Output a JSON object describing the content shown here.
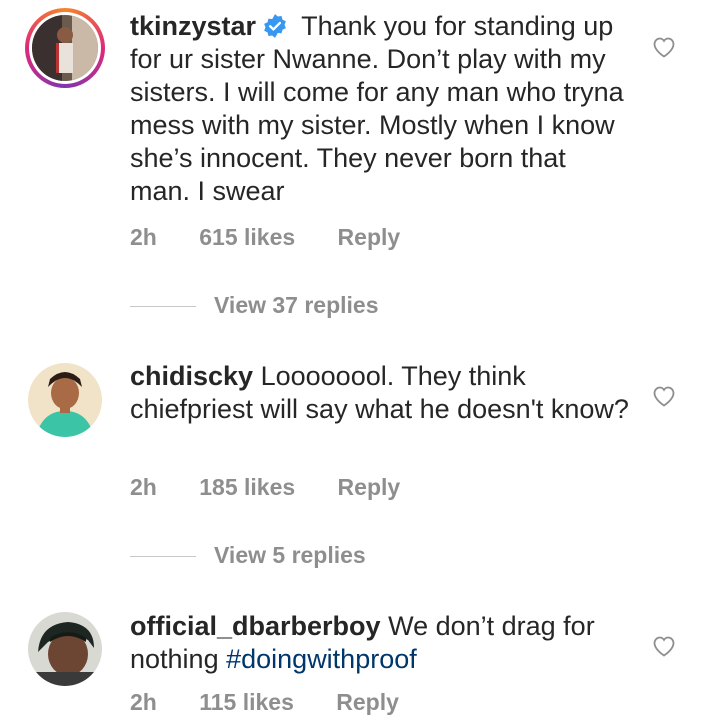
{
  "comments": [
    {
      "username": "tkinzystar",
      "verified": true,
      "text": "Thank you for standing up for ur sister Nwanne. Don’t play with my sisters. I will come for any man who tryna mess with my sister. Mostly when I know she’s innocent. They never born that man. I swear",
      "time": "2h",
      "likes": "615 likes",
      "reply_label": "Reply",
      "view_replies": "View 37 replies"
    },
    {
      "username": "chidiscky",
      "text": "Loooooool. They think chiefpriest will say what he doesn't know?",
      "time": "2h",
      "likes": "185 likes",
      "reply_label": "Reply",
      "view_replies": "View 5 replies"
    },
    {
      "username": "official_dbarberboy",
      "text": "We don’t drag for nothing",
      "hashtag": "#doingwithproof",
      "time": "2h",
      "likes": "115 likes",
      "reply_label": "Reply"
    }
  ],
  "icons": {
    "like": "heart-outline-icon",
    "verified": "verified-badge-icon"
  },
  "colors": {
    "text": "#262626",
    "muted": "#8e8e8e",
    "hashtag": "#00376b",
    "verified": "#3897f0"
  }
}
